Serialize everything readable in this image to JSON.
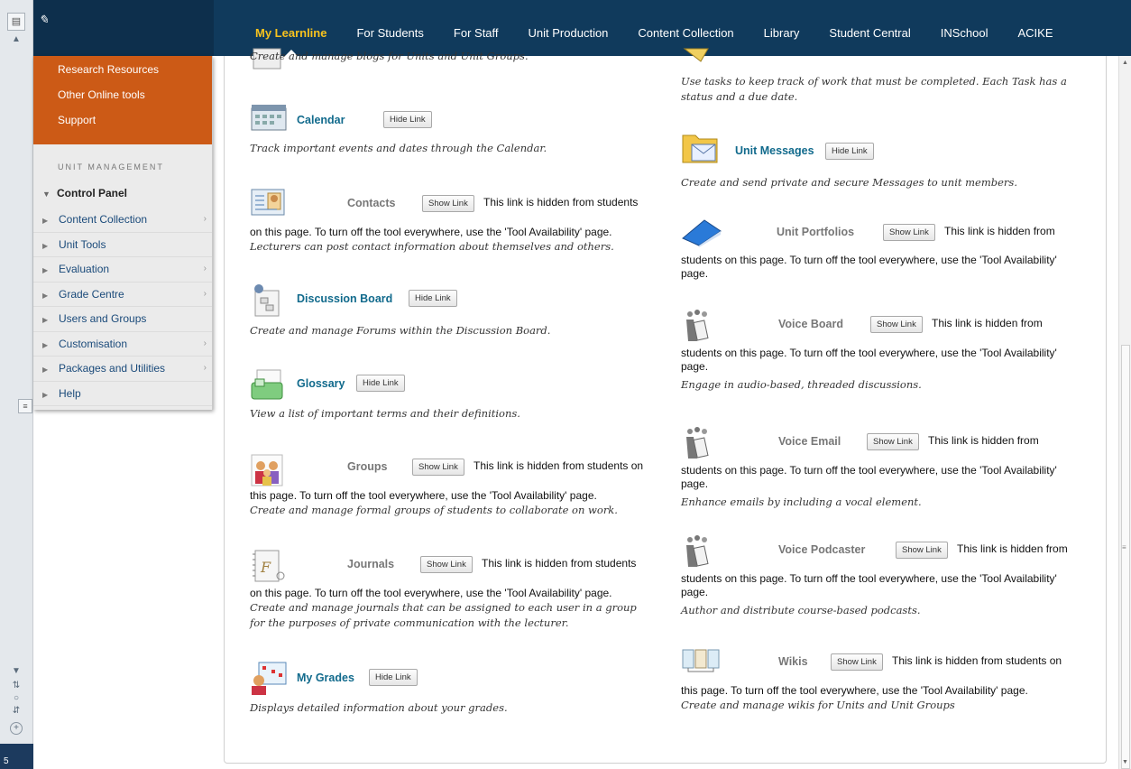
{
  "top_nav": {
    "tabs": [
      {
        "label": "My Learnline",
        "active": true
      },
      {
        "label": "For Students",
        "active": false
      },
      {
        "label": "For Staff",
        "active": false
      },
      {
        "label": "Unit Production",
        "active": false
      },
      {
        "label": "Content Collection",
        "active": false
      },
      {
        "label": "Library",
        "active": false
      },
      {
        "label": "Student Central",
        "active": false
      },
      {
        "label": "INSchool",
        "active": false
      },
      {
        "label": "ACIKE",
        "active": false
      }
    ]
  },
  "sidebar": {
    "orange_links": [
      "Research Resources",
      "Other Online tools",
      "Support"
    ],
    "section_title": "UNIT MANAGEMENT",
    "control_panel_label": "Control Panel",
    "items": [
      {
        "label": "Content Collection",
        "has_submenu": true
      },
      {
        "label": "Unit Tools",
        "has_submenu": false
      },
      {
        "label": "Evaluation",
        "has_submenu": true
      },
      {
        "label": "Grade Centre",
        "has_submenu": true
      },
      {
        "label": "Users and Groups",
        "has_submenu": false
      },
      {
        "label": "Customisation",
        "has_submenu": true
      },
      {
        "label": "Packages and Utilities",
        "has_submenu": true
      },
      {
        "label": "Help",
        "has_submenu": false
      }
    ],
    "colors": {
      "orange": "#cc5a16",
      "nav_bg": "#103a5c",
      "active_tab": "#f7c21e",
      "link": "#116a8c"
    }
  },
  "gutter": {
    "foot_label": "5"
  },
  "labels": {
    "hide_link": "Hide Link",
    "show_link": "Show Link",
    "hidden_note_prefix": "This link is hidden from",
    "hidden_note_rest": "students on this page. To turn off the tool everywhere, use the 'Tool Availability' page."
  },
  "tools_left": [
    {
      "id": "blogs",
      "desc": "Create and manage blogs for Units and Unit Groups.",
      "name": "",
      "icon": "blog-icon"
    },
    {
      "id": "calendar",
      "name": "Calendar",
      "visible": true,
      "icon": "calendar-icon",
      "desc": "Track important events and dates through the Calendar."
    },
    {
      "id": "contacts",
      "name": "Contacts",
      "visible": false,
      "icon": "contacts-icon",
      "note_inline": "This link is hidden from students",
      "note_wrap": "on this page. To turn off the tool everywhere, use the 'Tool Availability' page.",
      "desc": "Lecturers can post contact information about themselves and others."
    },
    {
      "id": "discussion",
      "name": "Discussion Board",
      "visible": true,
      "icon": "discussion-board-icon",
      "desc": "Create and manage Forums within the Discussion Board."
    },
    {
      "id": "glossary",
      "name": "Glossary",
      "visible": true,
      "icon": "glossary-icon",
      "desc": "View a list of important terms and their definitions."
    },
    {
      "id": "groups",
      "name": "Groups",
      "visible": false,
      "icon": "groups-icon",
      "note_inline": "This link is hidden from students on",
      "note_wrap": "this page. To turn off the tool everywhere, use the 'Tool Availability' page.",
      "desc": "Create and manage formal groups of students to collaborate on work."
    },
    {
      "id": "journals",
      "name": "Journals",
      "visible": false,
      "icon": "journal-icon",
      "note_inline": "This link is hidden from students",
      "note_wrap": "on this page. To turn off the tool everywhere, use the 'Tool Availability' page.",
      "desc": "Create and manage journals that can be assigned to each user in a group for the purposes of private communication with the lecturer."
    },
    {
      "id": "grades",
      "name": "My Grades",
      "visible": true,
      "icon": "grades-icon",
      "desc": "Displays detailed information about your grades."
    }
  ],
  "tools_right": [
    {
      "id": "tasks",
      "name": "",
      "icon": "tasks-icon",
      "desc": "Use tasks to keep track of work that must be completed. Each Task has a status and a due date."
    },
    {
      "id": "messages",
      "name": "Unit Messages",
      "visible": true,
      "icon": "messages-icon",
      "desc": "Create and send private and secure Messages to unit members."
    },
    {
      "id": "portfolios",
      "name": "Unit Portfolios",
      "visible": false,
      "icon": "portfolio-icon",
      "note_inline": "This link is hidden from",
      "note_wrap": "students on this page. To turn off the tool everywhere, use the 'Tool Availability' page.",
      "desc": ""
    },
    {
      "id": "voiceboard",
      "name": "Voice Board",
      "visible": false,
      "icon": "voice-board-icon",
      "note_inline": "This link is hidden from",
      "note_wrap": "students on this page. To turn off the tool everywhere, use the 'Tool Availability' page.",
      "desc": "Engage in audio-based, threaded discussions."
    },
    {
      "id": "voiceemail",
      "name": "Voice Email",
      "visible": false,
      "icon": "voice-email-icon",
      "note_inline": "This link is hidden from",
      "note_wrap": "students on this page. To turn off the tool everywhere, use the 'Tool Availability' page.",
      "desc": "Enhance emails by including a vocal element."
    },
    {
      "id": "podcaster",
      "name": "Voice Podcaster",
      "visible": false,
      "icon": "voice-podcaster-icon",
      "note_inline": "This link is hidden from",
      "note_wrap": "students on this page. To turn off the tool everywhere, use the 'Tool Availability' page.",
      "desc": "Author and distribute course-based podcasts."
    },
    {
      "id": "wikis",
      "name": "Wikis",
      "visible": false,
      "icon": "wiki-icon",
      "note_inline": "This link is hidden from students on",
      "note_wrap": "this page. To turn off the tool everywhere, use the 'Tool Availability' page.",
      "desc": "Create and manage wikis for Units and Unit Groups"
    }
  ]
}
